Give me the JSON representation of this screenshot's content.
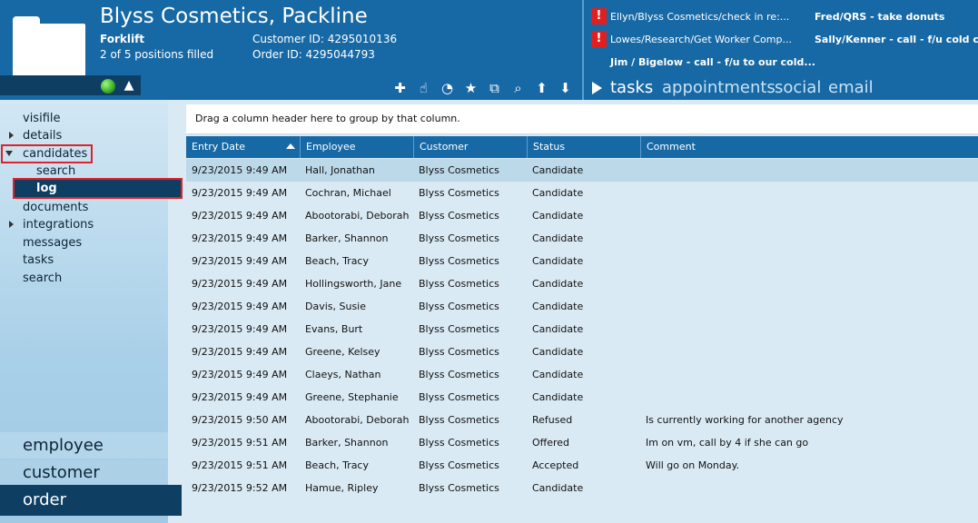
{
  "header": {
    "title": "Blyss Cosmetics, Packline",
    "position": "Forklift",
    "positions_filled": "2 of 5 positions filled",
    "customer_id": "Customer ID: 4295010136",
    "order_id": "Order ID: 4295044793"
  },
  "alerts": [
    {
      "icon": "!",
      "text": "Ellyn/Blyss Cosmetics/check in re:..."
    },
    {
      "icon": "!",
      "text": "Lowes/Research/Get Worker Comp..."
    }
  ],
  "tasks": [
    "Fred/QRS - take donuts",
    "Sally/Kenner - call - f/u cold call",
    "Jim / Bigelow - call - f/u to our cold..."
  ],
  "nav_tabs": [
    "tasks",
    "appointments",
    "social",
    "email"
  ],
  "toolbar_icons": [
    "plus-icon",
    "hand-icon",
    "pie-icon",
    "star-icon",
    "popout-icon",
    "search-icon",
    "arrow-up-icon",
    "arrow-down-icon"
  ],
  "sidebar": {
    "items": [
      "visifile",
      "details",
      "candidates",
      "documents",
      "integrations",
      "messages",
      "tasks",
      "search"
    ],
    "sub_items": [
      "search",
      "log"
    ],
    "big_nav": [
      "employee",
      "customer",
      "order"
    ]
  },
  "grid": {
    "group_hint": "Drag a column header here to group by that column.",
    "columns": [
      "Entry Date",
      "Employee",
      "Customer",
      "Status",
      "Comment"
    ],
    "rows": [
      [
        "9/23/2015 9:49 AM",
        "Hall, Jonathan",
        "Blyss Cosmetics",
        "Candidate",
        ""
      ],
      [
        "9/23/2015 9:49 AM",
        "Cochran, Michael",
        "Blyss Cosmetics",
        "Candidate",
        ""
      ],
      [
        "9/23/2015 9:49 AM",
        "Abootorabi, Deborah",
        "Blyss Cosmetics",
        "Candidate",
        ""
      ],
      [
        "9/23/2015 9:49 AM",
        "Barker, Shannon",
        "Blyss Cosmetics",
        "Candidate",
        ""
      ],
      [
        "9/23/2015 9:49 AM",
        "Beach, Tracy",
        "Blyss Cosmetics",
        "Candidate",
        ""
      ],
      [
        "9/23/2015 9:49 AM",
        "Hollingsworth, Jane",
        "Blyss Cosmetics",
        "Candidate",
        ""
      ],
      [
        "9/23/2015 9:49 AM",
        "Davis, Susie",
        "Blyss Cosmetics",
        "Candidate",
        ""
      ],
      [
        "9/23/2015 9:49 AM",
        "Evans, Burt",
        "Blyss Cosmetics",
        "Candidate",
        ""
      ],
      [
        "9/23/2015 9:49 AM",
        "Greene, Kelsey",
        "Blyss Cosmetics",
        "Candidate",
        ""
      ],
      [
        "9/23/2015 9:49 AM",
        "Claeys, Nathan",
        "Blyss Cosmetics",
        "Candidate",
        ""
      ],
      [
        "9/23/2015 9:49 AM",
        "Greene, Stephanie",
        "Blyss Cosmetics",
        "Candidate",
        ""
      ],
      [
        "9/23/2015 9:50 AM",
        "Abootorabi, Deborah",
        "Blyss Cosmetics",
        "Refused",
        "Is currently working for another agency"
      ],
      [
        "9/23/2015 9:51 AM",
        "Barker, Shannon",
        "Blyss Cosmetics",
        "Offered",
        "Im on vm, call by 4 if she can go"
      ],
      [
        "9/23/2015 9:51 AM",
        "Beach, Tracy",
        "Blyss Cosmetics",
        "Accepted",
        "Will go on Monday."
      ],
      [
        "9/23/2015 9:52 AM",
        "Hamue, Ripley",
        "Blyss Cosmetics",
        "Candidate",
        ""
      ]
    ]
  },
  "colors": {
    "header_bg": "#1769a6",
    "dark_nav": "#0e3f63",
    "highlight": "#e0202a",
    "status_ok": "#2a9d1a"
  }
}
